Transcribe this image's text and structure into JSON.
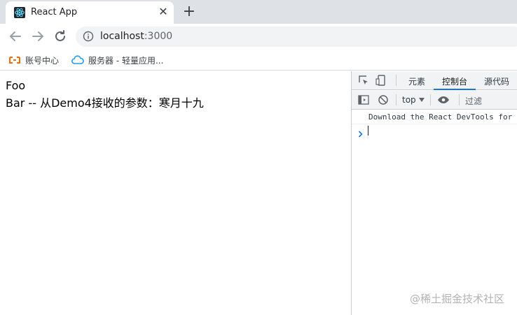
{
  "browser": {
    "tab": {
      "title": "React App",
      "close_glyph": "✕",
      "favicon": "react-icon"
    },
    "new_tab_glyph": "+",
    "url": {
      "host": "localhost",
      "port": ":3000"
    },
    "bookmarks": [
      {
        "label": "账号中心",
        "icon": "account-center-icon"
      },
      {
        "label": "服务器 - 轻量应用...",
        "icon": "cloud-icon"
      }
    ]
  },
  "page": {
    "lines": [
      "Foo",
      "Bar -- 从Demo4接收的参数：寒月十九"
    ]
  },
  "devtools": {
    "tabs": [
      {
        "label": "元素",
        "active": false
      },
      {
        "label": "控制台",
        "active": true
      },
      {
        "label": "源代码",
        "active": false
      }
    ],
    "context": "top",
    "filter_placeholder": "过滤",
    "console_message": "Download the React DevTools for",
    "accent": "#1a73e8"
  },
  "watermark": "@稀土掘金技术社区"
}
